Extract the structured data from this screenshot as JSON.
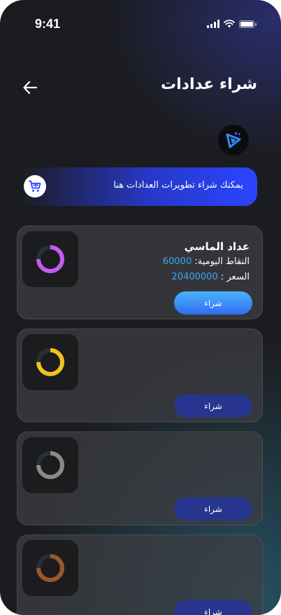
{
  "status_bar": {
    "time": "9:41"
  },
  "header": {
    "title": "شراء عدادات"
  },
  "banner": {
    "text": "يمكنك شراء تطويرات العدادات هنا"
  },
  "cards": [
    {
      "title": "عداد الماسي",
      "points_label": "النقاط اليومية:",
      "points_value": "60000",
      "price_label": "السعر :",
      "price_value": "20400000",
      "buy_label": "شراء",
      "ring_color": "#c35cf2"
    },
    {
      "buy_label": "شراء",
      "ring_color": "#f3c21f"
    },
    {
      "buy_label": "شراء",
      "ring_color": "#8a8a8a"
    },
    {
      "buy_label": "شراء",
      "ring_color": "#9a5a2a"
    }
  ],
  "colors": {
    "accent_blue": "#2b45ff",
    "value_blue": "#3fa9f5",
    "background": "#1b1c1f"
  },
  "icons": {
    "back": "arrow-left-icon",
    "cart": "shopping-cart-icon",
    "logo": "app-logo-icon",
    "wifi": "wifi-icon",
    "battery": "battery-icon",
    "signal": "signal-icon"
  }
}
